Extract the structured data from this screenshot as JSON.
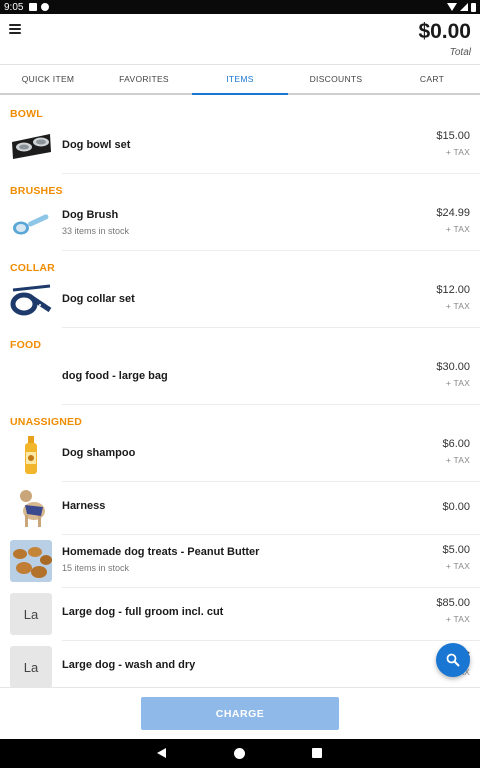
{
  "status_bar": {
    "time": "9:05"
  },
  "header": {
    "total": "$0.00",
    "total_label": "Total"
  },
  "tabs": [
    {
      "label": "QUICK ITEM",
      "active": false
    },
    {
      "label": "FAVORITES",
      "active": false
    },
    {
      "label": "ITEMS",
      "active": true
    },
    {
      "label": "DISCOUNTS",
      "active": false
    },
    {
      "label": "CART",
      "active": false
    }
  ],
  "categories": {
    "bowl": "BOWL",
    "brushes": "BRUSHES",
    "collar": "COLLAR",
    "food": "FOOD",
    "unassigned": "UNASSIGNED"
  },
  "items": {
    "dog_bowl_set": {
      "name": "Dog bowl set",
      "price": "$15.00",
      "tax": "+ TAX"
    },
    "dog_brush": {
      "name": "Dog Brush",
      "stock": "33 items in stock",
      "price": "$24.99",
      "tax": "+ TAX"
    },
    "dog_collar_set": {
      "name": "Dog collar set",
      "price": "$12.00",
      "tax": "+ TAX"
    },
    "dog_food": {
      "name": "dog food - large bag",
      "price": "$30.00",
      "tax": "+ TAX"
    },
    "dog_shampoo": {
      "name": "Dog shampoo",
      "price": "$6.00",
      "tax": "+ TAX"
    },
    "harness": {
      "name": "Harness",
      "price": "$0.00"
    },
    "treats": {
      "name": "Homemade dog treats - Peanut Butter",
      "stock": "15 items in stock",
      "price": "$5.00",
      "tax": "+ TAX"
    },
    "groom": {
      "name": "Large dog - full groom incl. cut",
      "thumb_text": "La",
      "price": "$85.00",
      "tax": "+ TAX"
    },
    "wash": {
      "name": "Large dog - wash and dry",
      "thumb_text": "La",
      "price": "$",
      "tax": "+ TAX"
    }
  },
  "footer": {
    "charge_label": "CHARGE"
  },
  "colors": {
    "accent": "#1976d2",
    "category": "#f08c00",
    "charge_disabled": "#8fb9e8"
  },
  "icons": [
    "menu-icon",
    "search-icon",
    "nav-back-icon",
    "nav-home-icon",
    "nav-recents-icon"
  ]
}
